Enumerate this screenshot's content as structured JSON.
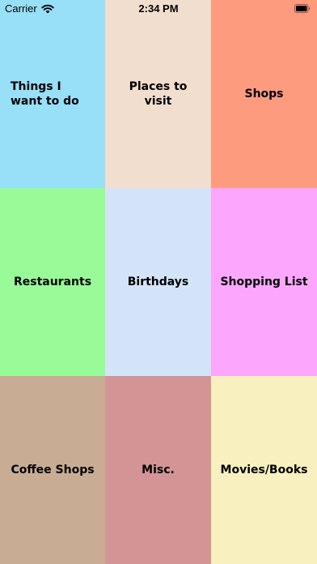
{
  "status_bar": {
    "carrier": "Carrier",
    "time": "2:34 PM",
    "icons": {
      "wifi": "wifi-icon",
      "battery": "battery-icon"
    }
  },
  "categories": [
    {
      "label": "Things I want to do",
      "color": "#98DFF8",
      "align": "left"
    },
    {
      "label": "Places to visit",
      "color": "#F2DECE",
      "align": "center"
    },
    {
      "label": "Shops",
      "color": "#FD9B7F",
      "align": "center"
    },
    {
      "label": "Restaurants",
      "color": "#99FA98",
      "align": "center"
    },
    {
      "label": "Birthdays",
      "color": "#D4E4F8",
      "align": "center"
    },
    {
      "label": "Shopping List",
      "color": "#FDA6FD",
      "align": "center"
    },
    {
      "label": "Coffee Shops",
      "color": "#C8AD94",
      "align": "center"
    },
    {
      "label": "Misc.",
      "color": "#D29494",
      "align": "center"
    },
    {
      "label": "Movies/Books",
      "color": "#F8F0BE",
      "align": "center"
    }
  ]
}
